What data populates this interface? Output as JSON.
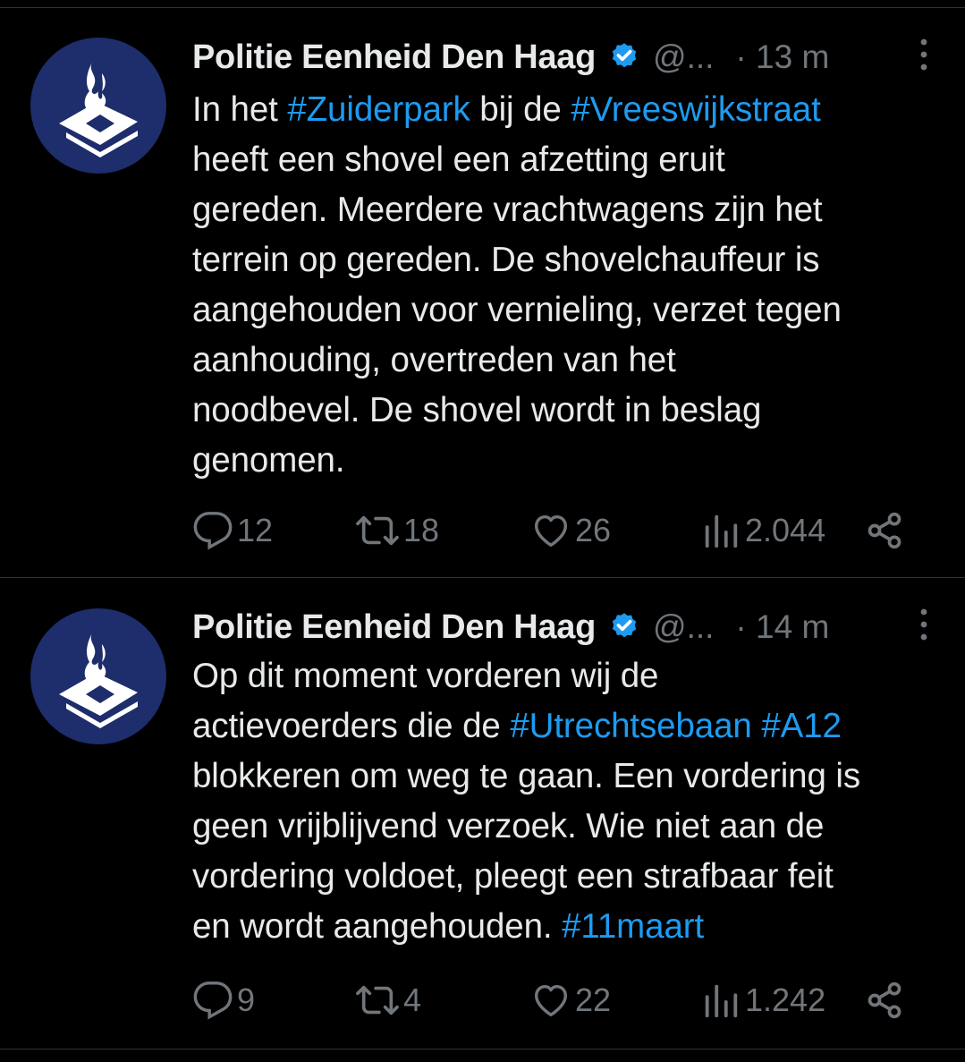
{
  "tweets": [
    {
      "author": {
        "display_name": "Politie Eenheid Den Haag",
        "handle": "@...",
        "verified": true,
        "avatar_icon": "police-flame-logo"
      },
      "time": "· 13 m",
      "text_lines": [
        [
          {
            "t": "In het ",
            "tag": false
          },
          {
            "t": "#Zuiderpark",
            "tag": true
          },
          {
            "t": " bij de ",
            "tag": false
          },
          {
            "t": "#Vreeswijkstraat",
            "tag": true
          }
        ],
        [
          {
            "t": "heeft een shovel een afzetting eruit",
            "tag": false
          }
        ],
        [
          {
            "t": "gereden. Meerdere vrachtwagens zijn het",
            "tag": false
          }
        ],
        [
          {
            "t": "terrein op gereden. De shovelchauffeur is",
            "tag": false
          }
        ],
        [
          {
            "t": "aangehouden voor vernieling, verzet tegen",
            "tag": false
          }
        ],
        [
          {
            "t": "aanhouding, overtreden van het",
            "tag": false
          }
        ],
        [
          {
            "t": "noodbevel. De shovel wordt in beslag",
            "tag": false
          }
        ],
        [
          {
            "t": "genomen.",
            "tag": false
          }
        ]
      ],
      "stats": {
        "replies": "12",
        "retweets": "18",
        "likes": "26",
        "views": "2.044"
      }
    },
    {
      "author": {
        "display_name": "Politie Eenheid Den Haag",
        "handle": "@...",
        "verified": true,
        "avatar_icon": "police-flame-logo"
      },
      "time": "· 14 m",
      "text_lines": [
        [
          {
            "t": "Op dit moment vorderen wij de",
            "tag": false
          }
        ],
        [
          {
            "t": "actievoerders die de ",
            "tag": false
          },
          {
            "t": "#Utrechtsebaan",
            "tag": true
          },
          {
            "t": " ",
            "tag": false
          },
          {
            "t": "#A12",
            "tag": true
          }
        ],
        [
          {
            "t": "blokkeren om weg te gaan. Een vordering is",
            "tag": false
          }
        ],
        [
          {
            "t": "geen vrijblijvend verzoek. Wie niet aan de",
            "tag": false
          }
        ],
        [
          {
            "t": "vordering voldoet, pleegt een strafbaar feit",
            "tag": false
          }
        ],
        [
          {
            "t": "en wordt aangehouden. ",
            "tag": false
          },
          {
            "t": "#11maart",
            "tag": true
          }
        ]
      ],
      "stats": {
        "replies": "9",
        "retweets": "4",
        "likes": "22",
        "views": "1.242"
      }
    }
  ],
  "colors": {
    "background": "#000000",
    "text": "#e7e9ea",
    "secondary": "#71767b",
    "link": "#1d9bf0",
    "verified": "#1d9bf0",
    "avatar_bg": "#1e2d6b",
    "divider": "#2f3336"
  },
  "icons": {
    "reply": "reply-icon",
    "retweet": "retweet-icon",
    "like": "heart-icon",
    "views": "views-chart-icon",
    "share": "share-icon",
    "more": "more-vertical-icon",
    "verified": "verified-badge-icon"
  }
}
